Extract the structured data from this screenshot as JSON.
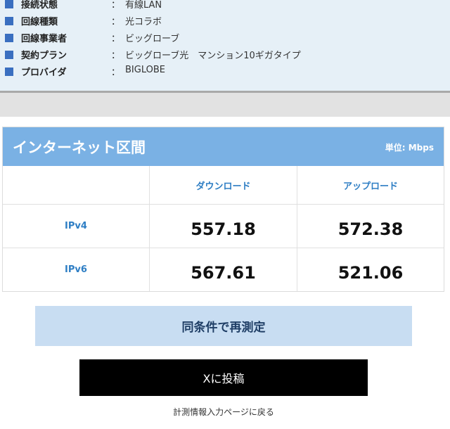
{
  "connection_info": [
    {
      "label": "接続状態",
      "value": "有線LAN"
    },
    {
      "label": "回線種類",
      "value": "光コラボ"
    },
    {
      "label": "回線事業者",
      "value": "ビッグローブ"
    },
    {
      "label": "契約プラン",
      "value": "ビッグローブ光　マンション10ギガタイプ"
    },
    {
      "label": "プロバイダ",
      "value": "BIGLOBE"
    }
  ],
  "separator": "：",
  "results": {
    "title": "インターネット区間",
    "unit": "単位: Mbps",
    "columns": [
      "ダウンロード",
      "アップロード"
    ],
    "rows": [
      {
        "label": "IPv4",
        "download": "557.18",
        "upload": "572.38"
      },
      {
        "label": "IPv6",
        "download": "567.61",
        "upload": "521.06"
      }
    ]
  },
  "actions": {
    "retest_label": "同条件で再測定",
    "post_x_label": "Xに投稿",
    "back_link_label": "計測情報入力ページに戻る"
  },
  "colors": {
    "header_blue": "#7ab1e4",
    "accent_blue": "#2e7ec4",
    "retest_bg": "#c8ddf2",
    "x_button_bg": "#000000"
  }
}
